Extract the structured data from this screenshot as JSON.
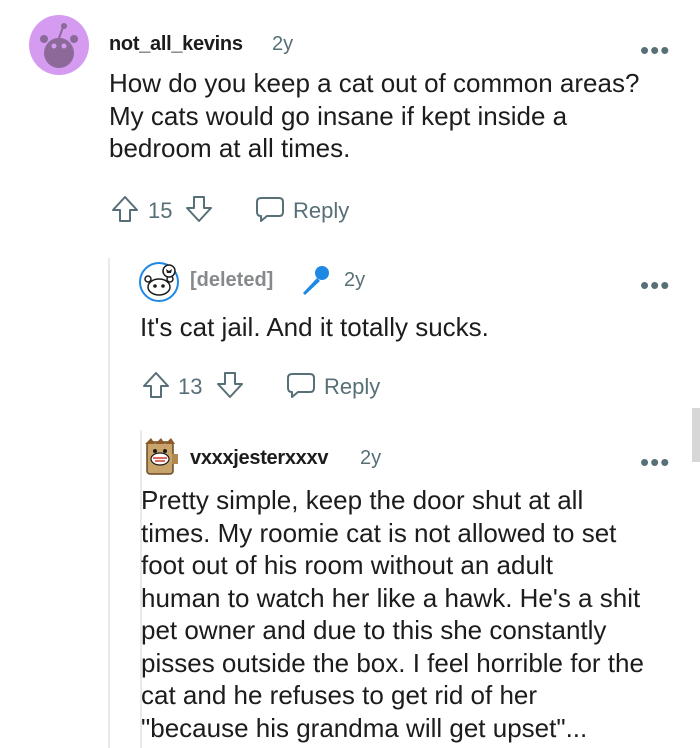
{
  "comments": [
    {
      "username": "not_all_kevins",
      "age": "2y",
      "more": "•••",
      "body": [
        "How do you keep a cat out of common areas?",
        "My cats would go insane if kept inside a",
        "bedroom at all times."
      ],
      "votes": "15",
      "reply_label": "Reply",
      "avatar_color": "#d49bf0"
    },
    {
      "username": "[deleted]",
      "age": "2y",
      "more": "•••",
      "body": [
        "It's cat jail. And it totally sucks."
      ],
      "votes": "13",
      "reply_label": "Reply",
      "badge_icon": "microphone-icon",
      "badge_color": "#1e88e5"
    },
    {
      "username": "vxxxjesterxxxv",
      "age": "2y",
      "more": "•••",
      "body": [
        "Pretty simple, keep the door shut at all",
        "times. My roomie cat is not allowed to set",
        "foot out of his room without an adult",
        "human to watch her like a hawk. He's a shit",
        "pet owner and due to this she constantly",
        "pisses outside the box. I feel horrible for the",
        "cat and he refuses to get rid of her",
        "\"because his grandma will get upset\"..."
      ]
    }
  ]
}
